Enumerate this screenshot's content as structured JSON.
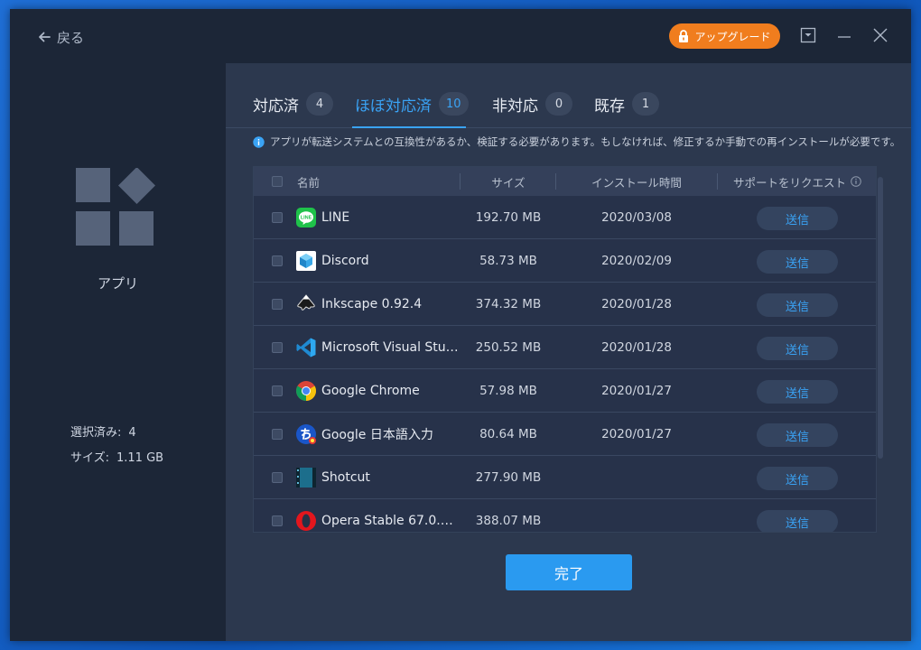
{
  "titlebar": {
    "back_label": "戻る",
    "upgrade_label": "アップグレード"
  },
  "sidebar": {
    "title": "アプリ",
    "selected_label": "選択済み:",
    "selected_value": "4",
    "size_label": "サイズ:",
    "size_value": "1.11 GB"
  },
  "tabs": [
    {
      "label": "対応済",
      "count": "4"
    },
    {
      "label": "ほぼ対応済",
      "count": "10"
    },
    {
      "label": "非対応",
      "count": "0"
    },
    {
      "label": "既存",
      "count": "1"
    }
  ],
  "notice": "アプリが転送システムとの互換性があるか、検証する必要があります。もしなければ、修正するか手動での再インストールが必要です。",
  "table": {
    "headers": {
      "name": "名前",
      "size": "サイズ",
      "install_time": "インストール時間",
      "support": "サポートをリクエスト"
    },
    "send_label": "送信",
    "rows": [
      {
        "name": "LINE",
        "size": "192.70 MB",
        "date": "2020/03/08",
        "icon": "line-icon"
      },
      {
        "name": "Discord",
        "size": "58.73 MB",
        "date": "2020/02/09",
        "icon": "discord-icon"
      },
      {
        "name": "Inkscape 0.92.4",
        "size": "374.32 MB",
        "date": "2020/01/28",
        "icon": "inkscape-icon"
      },
      {
        "name": "Microsoft Visual Stu…",
        "size": "250.52 MB",
        "date": "2020/01/28",
        "icon": "vscode-icon"
      },
      {
        "name": "Google Chrome",
        "size": "57.98 MB",
        "date": "2020/01/27",
        "icon": "chrome-icon"
      },
      {
        "name": "Google 日本語入力",
        "size": "80.64 MB",
        "date": "2020/01/27",
        "icon": "google-ime-icon"
      },
      {
        "name": "Shotcut",
        "size": "277.90 MB",
        "date": "",
        "icon": "shotcut-icon"
      },
      {
        "name": "Opera Stable 67.0.…",
        "size": "388.07 MB",
        "date": "",
        "icon": "opera-icon"
      }
    ]
  },
  "done_label": "完了",
  "colors": {
    "accent": "#3aa3f5",
    "upgrade": "#f07d1e",
    "window_bg": "#263247",
    "sidebar_bg": "#1c2637"
  }
}
